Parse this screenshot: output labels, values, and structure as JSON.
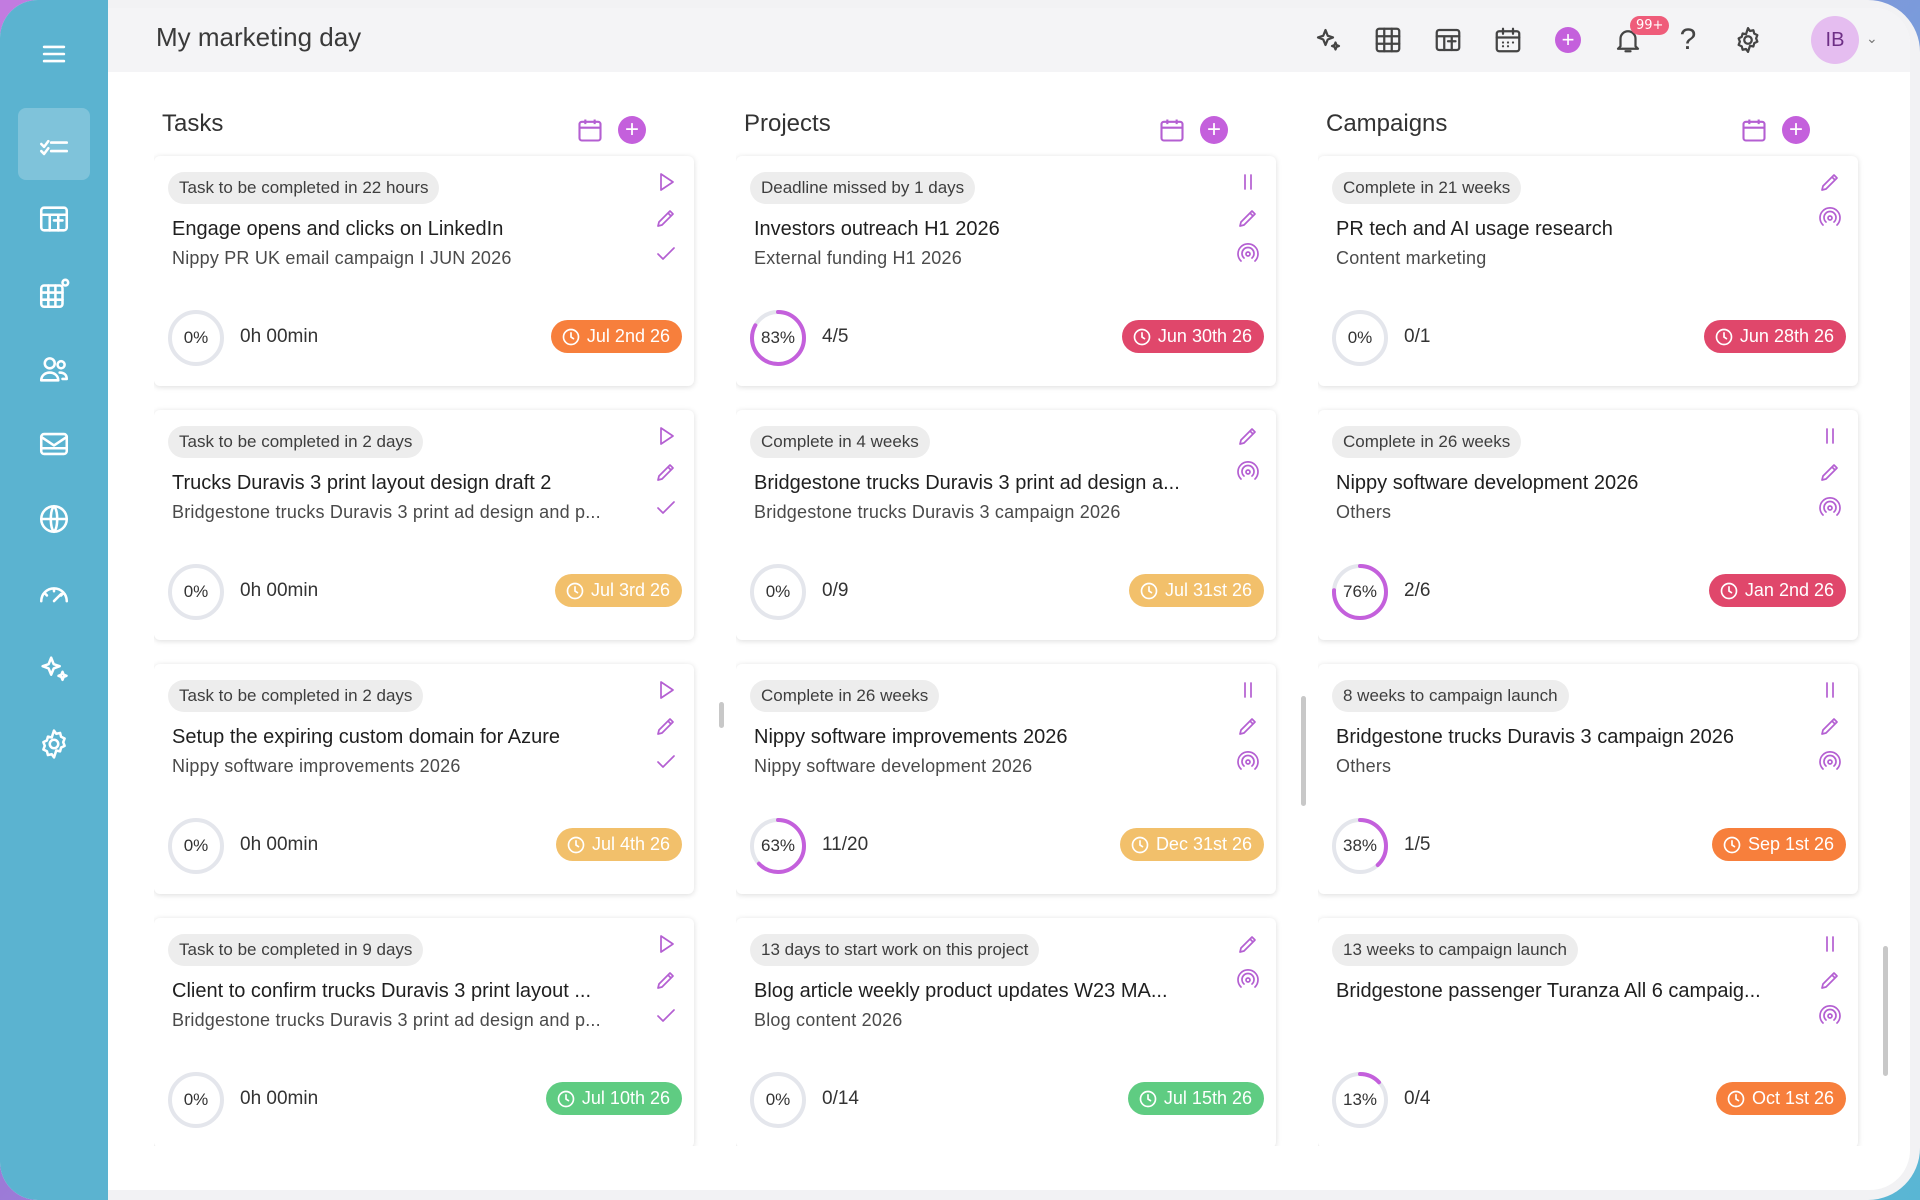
{
  "header": {
    "title": "My marketing day",
    "notification_count": "99+",
    "help_label": "?",
    "avatar_initials": "IB"
  },
  "sidebar": {
    "items": [
      {
        "name": "menu",
        "icon": "hamburger-icon"
      },
      {
        "name": "my-day",
        "icon": "checklist-icon",
        "active": true
      },
      {
        "name": "boards",
        "icon": "kanban-icon"
      },
      {
        "name": "grid-settings",
        "icon": "grid-gear-icon"
      },
      {
        "name": "team",
        "icon": "users-icon"
      },
      {
        "name": "email",
        "icon": "mail-icon"
      },
      {
        "name": "web",
        "icon": "globe-icon"
      },
      {
        "name": "dashboard",
        "icon": "speedometer-icon"
      },
      {
        "name": "ai",
        "icon": "sparkles-icon"
      },
      {
        "name": "settings",
        "icon": "gear-icon"
      }
    ]
  },
  "colors": {
    "accent": "#c460dc",
    "orange": "#f77f3c",
    "amber": "#f2c06b",
    "red": "#e0476b",
    "green": "#5fcc82",
    "sidebar": "#5bb3d0"
  },
  "columns": [
    {
      "title": "Tasks",
      "cards": [
        {
          "tag": "Task to be completed in 22 hours",
          "title": "Engage opens and clicks on LinkedIn",
          "subtitle": "Nippy PR UK email campaign I JUN 2026",
          "progress": 0,
          "progress_label": "0%",
          "metric": "0h 00min",
          "due": "Jul 2nd 26",
          "due_color": "#f77f3c"
        },
        {
          "tag": "Task to be completed in 2 days",
          "title": "Trucks Duravis 3 print layout design draft 2",
          "subtitle": "Bridgestone trucks Duravis 3 print ad design and p...",
          "progress": 0,
          "progress_label": "0%",
          "metric": "0h 00min",
          "due": "Jul 3rd 26",
          "due_color": "#f2c06b"
        },
        {
          "tag": "Task to be completed in 2 days",
          "title": "Setup the expiring custom domain for Azure",
          "subtitle": "Nippy software improvements 2026",
          "progress": 0,
          "progress_label": "0%",
          "metric": "0h 00min",
          "due": "Jul 4th 26",
          "due_color": "#f2c06b"
        },
        {
          "tag": "Task to be completed in 9 days",
          "title": "Client to confirm trucks Duravis 3 print layout ...",
          "subtitle": "Bridgestone trucks Duravis 3 print ad design and p...",
          "progress": 0,
          "progress_label": "0%",
          "metric": "0h 00min",
          "due": "Jul 10th 26",
          "due_color": "#5fcc82"
        }
      ]
    },
    {
      "title": "Projects",
      "cards": [
        {
          "tag": "Deadline missed by 1 days",
          "title": "Investors outreach H1 2026",
          "subtitle": "External funding H1 2026",
          "progress": 0.83,
          "progress_label": "83%",
          "metric": "4/5",
          "due": "Jun 30th 26",
          "due_color": "#e0476b"
        },
        {
          "tag": "Complete in 4 weeks",
          "title": "Bridgestone trucks Duravis 3 print ad design a...",
          "subtitle": "Bridgestone trucks Duravis 3 campaign 2026",
          "progress": 0,
          "progress_label": "0%",
          "metric": "0/9",
          "due": "Jul 31st 26",
          "due_color": "#f2c06b"
        },
        {
          "tag": "Complete in 26 weeks",
          "title": "Nippy software improvements 2026",
          "subtitle": "Nippy software development 2026",
          "progress": 0.63,
          "progress_label": "63%",
          "metric": "11/20",
          "due": "Dec 31st 26",
          "due_color": "#f2c06b"
        },
        {
          "tag": "13 days to start work on this project",
          "title": "Blog article weekly product updates W23 MA...",
          "subtitle": "Blog content 2026",
          "progress": 0,
          "progress_label": "0%",
          "metric": "0/14",
          "due": "Jul 15th 26",
          "due_color": "#5fcc82"
        }
      ]
    },
    {
      "title": "Campaigns",
      "cards": [
        {
          "tag": "Complete in 21 weeks",
          "title": "PR tech and AI usage research",
          "subtitle": "Content marketing",
          "progress": 0,
          "progress_label": "0%",
          "metric": "0/1",
          "due": "Jun 28th 26",
          "due_color": "#e0476b"
        },
        {
          "tag": "Complete in 26 weeks",
          "title": "Nippy software development 2026",
          "subtitle": "Others",
          "progress": 0.76,
          "progress_label": "76%",
          "metric": "2/6",
          "due": "Jan 2nd 26",
          "due_color": "#e0476b"
        },
        {
          "tag": "8 weeks to campaign launch",
          "title": "Bridgestone trucks Duravis 3 campaign 2026",
          "subtitle": "Others",
          "progress": 0.38,
          "progress_label": "38%",
          "metric": "1/5",
          "due": "Sep 1st 26",
          "due_color": "#f77f3c"
        },
        {
          "tag": "13 weeks to campaign launch",
          "title": "Bridgestone passenger Turanza All 6 campaig...",
          "subtitle": "",
          "progress": 0.13,
          "progress_label": "13%",
          "metric": "0/4",
          "due": "Oct 1st 26",
          "due_color": "#f77f3c"
        }
      ]
    }
  ]
}
